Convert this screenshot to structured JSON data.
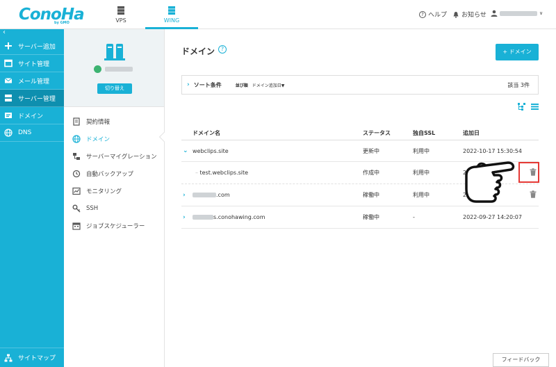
{
  "header": {
    "logo": "ConoHa",
    "logo_sub": "by GMO",
    "tabs": [
      {
        "label": "VPS"
      },
      {
        "label": "WING"
      }
    ],
    "help": "ヘルプ",
    "notice": "お知らせ"
  },
  "sidebar": {
    "items": [
      {
        "label": "サーバー追加",
        "icon": "plus-icon"
      },
      {
        "label": "サイト管理",
        "icon": "site-icon"
      },
      {
        "label": "メール管理",
        "icon": "mail-icon"
      },
      {
        "label": "サーバー管理",
        "icon": "server-icon"
      },
      {
        "label": "ドメイン",
        "icon": "domain-icon"
      },
      {
        "label": "DNS",
        "icon": "globe-icon"
      }
    ],
    "footer": "サイトマップ"
  },
  "subpanel": {
    "switch_label": "切り替え",
    "menu": [
      {
        "label": "契約情報"
      },
      {
        "label": "ドメイン"
      },
      {
        "label": "サーバーマイグレーション"
      },
      {
        "label": "自動バックアップ"
      },
      {
        "label": "モニタリング"
      },
      {
        "label": "SSH"
      },
      {
        "label": "ジョブスケジューラー"
      }
    ]
  },
  "main": {
    "title": "ドメイン",
    "add_button": "ドメイン",
    "sort": {
      "label": "ソート条件",
      "order_label": "並び順",
      "order_value": "ドメイン追加日▼",
      "count": "該当 3件"
    },
    "table": {
      "headers": [
        "ドメイン名",
        "ステータス",
        "独自SSL",
        "追加日"
      ],
      "rows": [
        {
          "name": "webclips.site",
          "status": "更新中",
          "ssl": "利用中",
          "date": "2022-10-17 15:30:54"
        },
        {
          "name": "test.webclips.site",
          "status": "作成中",
          "ssl": "利用中",
          "date": "2022-10-17"
        },
        {
          "name": ".com",
          "status": "稼働中",
          "ssl": "利用中",
          "date": "2022-  21:02"
        },
        {
          "name": "s.conohawing.com",
          "status": "稼働中",
          "ssl": "-",
          "date": "2022-09-27 14:20:07"
        }
      ]
    }
  },
  "feedback": "フィードバック",
  "colors": {
    "accent": "#19b1d6",
    "highlight": "#e53935"
  }
}
